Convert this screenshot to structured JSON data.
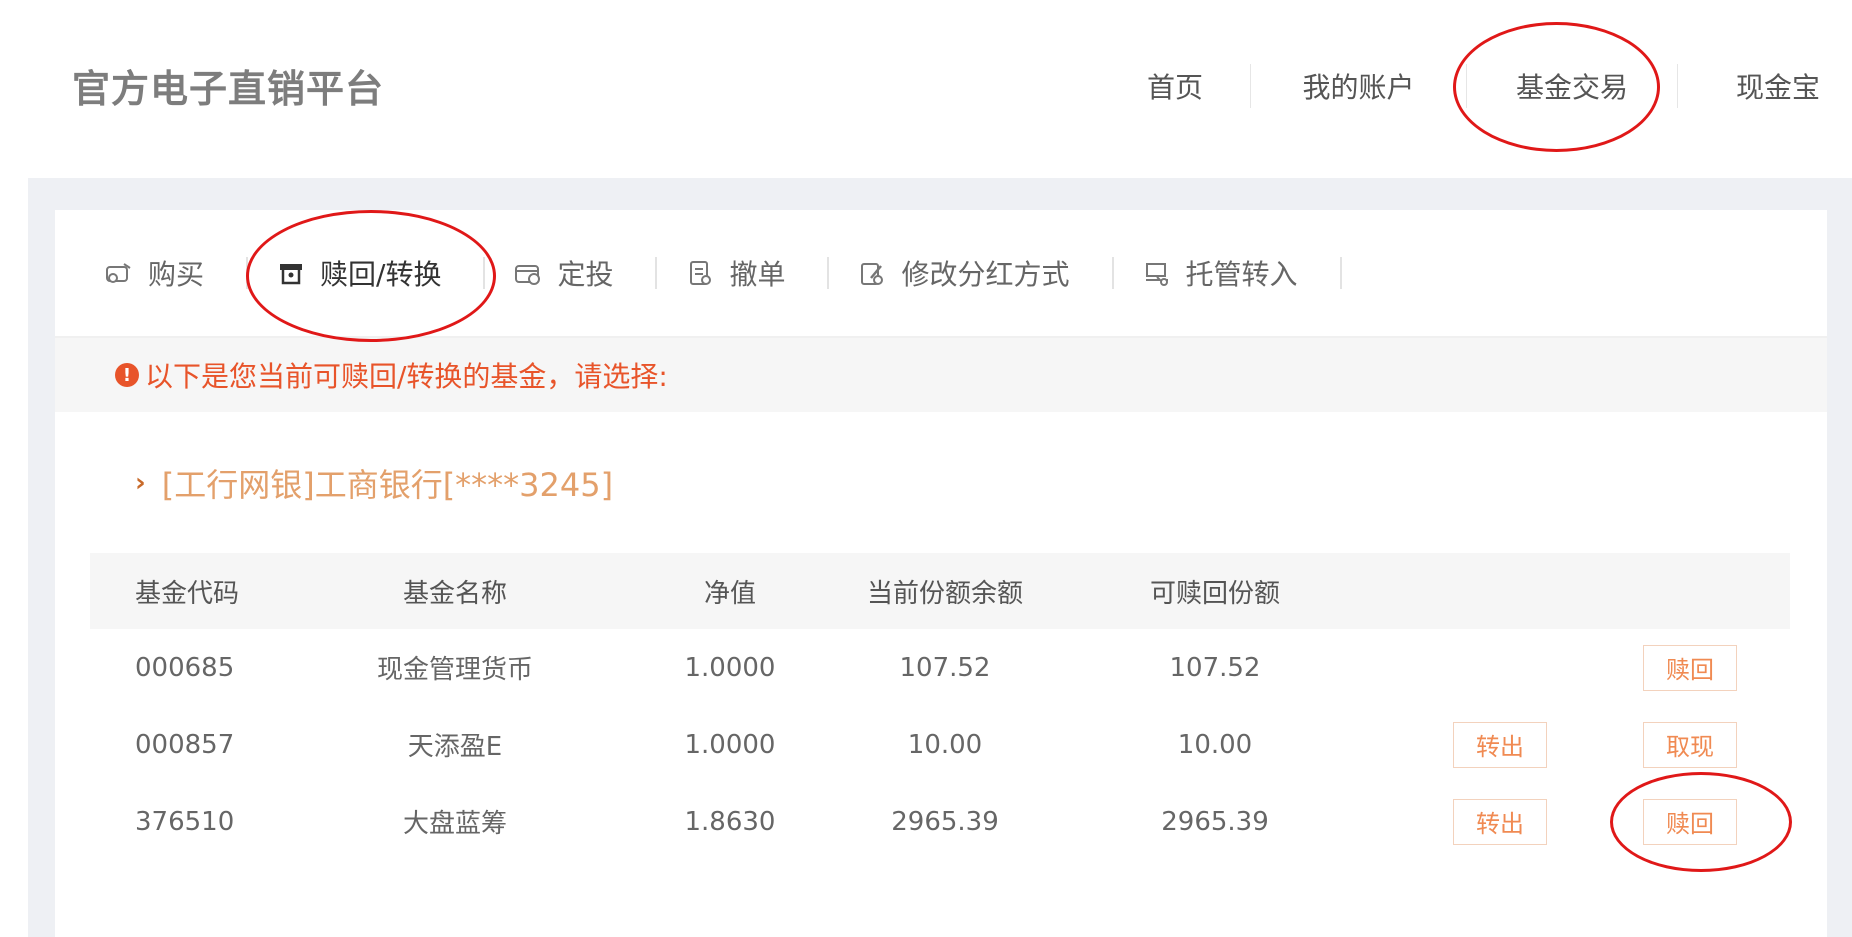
{
  "header": {
    "site_title": "官方电子直销平台",
    "nav": [
      "首页",
      "我的账户",
      "基金交易",
      "现金宝"
    ]
  },
  "sub_tabs": [
    {
      "label": "购买",
      "icon": "purchase-icon"
    },
    {
      "label": "赎回/转换",
      "icon": "redeem-icon"
    },
    {
      "label": "定投",
      "icon": "fixed-investment-icon"
    },
    {
      "label": "撤单",
      "icon": "cancel-order-icon"
    },
    {
      "label": "修改分红方式",
      "icon": "dividend-edit-icon"
    },
    {
      "label": "托管转入",
      "icon": "custody-transfer-icon"
    }
  ],
  "notice": {
    "text": "以下是您当前可赎回/转换的基金，请选择:"
  },
  "bank_account": {
    "label": "[工行网银]工商银行[****3245]"
  },
  "table": {
    "headers": [
      "基金代码",
      "基金名称",
      "净值",
      "当前份额余额",
      "可赎回份额"
    ],
    "rows": [
      {
        "code": "000685",
        "name": "现金管理货币",
        "nav": "1.0000",
        "share": "107.52",
        "redeemable": "107.52",
        "action1": "",
        "action2": "赎回"
      },
      {
        "code": "000857",
        "name": "天添盈E",
        "nav": "1.0000",
        "share": "10.00",
        "redeemable": "10.00",
        "action1": "转出",
        "action2": "取现"
      },
      {
        "code": "376510",
        "name": "大盘蓝筹",
        "nav": "1.8630",
        "share": "2965.39",
        "redeemable": "2965.39",
        "action1": "转出",
        "action2": "赎回"
      }
    ]
  },
  "colors": {
    "accent_orange": "#f08a52",
    "notice_red": "#e8542a",
    "annotation_red": "#e01818"
  }
}
